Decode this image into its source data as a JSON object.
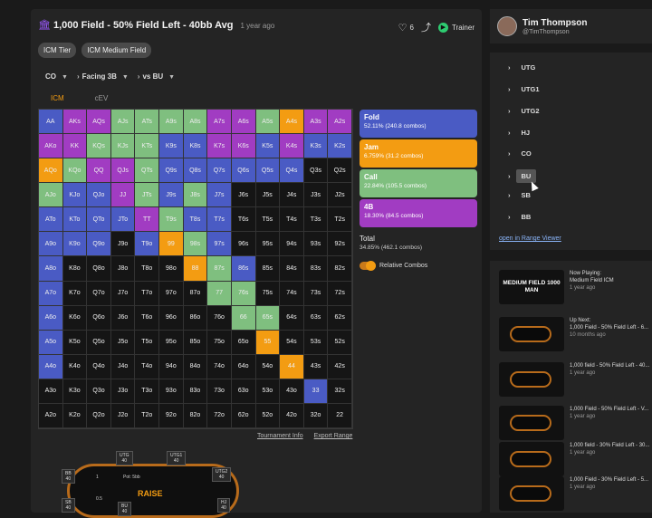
{
  "header": {
    "title": "1,000 Field - 50% Field Left - 40bb Avg",
    "time": "1 year ago",
    "likes": "6",
    "trainer_label": "Trainer"
  },
  "chips": [
    "ICM Tier",
    "ICM Medium Field"
  ],
  "selectors": {
    "position": "CO",
    "facing": "Facing 3B",
    "vs": "vs BU"
  },
  "tabs": [
    "ICM",
    "cEV"
  ],
  "colors": {
    "fold": "#4a5bc4",
    "jam": "#f39c12",
    "call": "#7fbf7f",
    "fourbet": "#a13cc2",
    "empty": "#151515"
  },
  "grid": {
    "labels": [
      [
        "AA",
        "AKs",
        "AQs",
        "AJs",
        "ATs",
        "A9s",
        "A8s",
        "A7s",
        "A6s",
        "A5s",
        "A4s",
        "A3s",
        "A2s"
      ],
      [
        "AKo",
        "KK",
        "KQs",
        "KJs",
        "KTs",
        "K9s",
        "K8s",
        "K7s",
        "K6s",
        "K5s",
        "K4s",
        "K3s",
        "K2s"
      ],
      [
        "AQo",
        "KQo",
        "QQ",
        "QJs",
        "QTs",
        "Q9s",
        "Q8s",
        "Q7s",
        "Q6s",
        "Q5s",
        "Q4s",
        "Q3s",
        "Q2s"
      ],
      [
        "AJo",
        "KJo",
        "QJo",
        "JJ",
        "JTs",
        "J9s",
        "J8s",
        "J7s",
        "J6s",
        "J5s",
        "J4s",
        "J3s",
        "J2s"
      ],
      [
        "ATo",
        "KTo",
        "QTo",
        "JTo",
        "TT",
        "T9s",
        "T8s",
        "T7s",
        "T6s",
        "T5s",
        "T4s",
        "T3s",
        "T2s"
      ],
      [
        "A9o",
        "K9o",
        "Q9o",
        "J9o",
        "T9o",
        "99",
        "98s",
        "97s",
        "96s",
        "95s",
        "94s",
        "93s",
        "92s"
      ],
      [
        "A8o",
        "K8o",
        "Q8o",
        "J8o",
        "T8o",
        "98o",
        "88",
        "87s",
        "86s",
        "85s",
        "84s",
        "83s",
        "82s"
      ],
      [
        "A7o",
        "K7o",
        "Q7o",
        "J7o",
        "T7o",
        "97o",
        "87o",
        "77",
        "76s",
        "75s",
        "74s",
        "73s",
        "72s"
      ],
      [
        "A6o",
        "K6o",
        "Q6o",
        "J6o",
        "T6o",
        "96o",
        "86o",
        "76o",
        "66",
        "65s",
        "64s",
        "63s",
        "62s"
      ],
      [
        "A5o",
        "K5o",
        "Q5o",
        "J5o",
        "T5o",
        "95o",
        "85o",
        "75o",
        "65o",
        "55",
        "54s",
        "53s",
        "52s"
      ],
      [
        "A4o",
        "K4o",
        "Q4o",
        "J4o",
        "T4o",
        "94o",
        "84o",
        "74o",
        "64o",
        "54o",
        "44",
        "43s",
        "42s"
      ],
      [
        "A3o",
        "K3o",
        "Q3o",
        "J3o",
        "T3o",
        "93o",
        "83o",
        "73o",
        "63o",
        "53o",
        "43o",
        "33",
        "32s"
      ],
      [
        "A2o",
        "K2o",
        "Q2o",
        "J2o",
        "T2o",
        "92o",
        "82o",
        "72o",
        "62o",
        "52o",
        "42o",
        "32o",
        "22"
      ]
    ],
    "fills": [
      [
        "F",
        "P",
        "P",
        "G",
        "G",
        "G",
        "G",
        "P",
        "P",
        "G",
        "J",
        "P",
        "P"
      ],
      [
        "P",
        "P",
        "G",
        "G",
        "G",
        "F",
        "F",
        "P",
        "P",
        "F",
        "P",
        "F",
        "F"
      ],
      [
        "J",
        "G",
        "P",
        "P",
        "G",
        "F",
        "F",
        "F",
        "F",
        "F",
        "F",
        "E",
        "E"
      ],
      [
        "G",
        "F",
        "F",
        "P",
        "G",
        "F",
        "G",
        "F",
        "E",
        "E",
        "E",
        "E",
        "E"
      ],
      [
        "F",
        "F",
        "F",
        "F",
        "P",
        "G",
        "F",
        "F",
        "E",
        "E",
        "E",
        "E",
        "E"
      ],
      [
        "F",
        "F",
        "F",
        "E",
        "F",
        "J",
        "G",
        "F",
        "E",
        "E",
        "E",
        "E",
        "E"
      ],
      [
        "F",
        "E",
        "E",
        "E",
        "E",
        "E",
        "J",
        "G",
        "F",
        "E",
        "E",
        "E",
        "E"
      ],
      [
        "F",
        "E",
        "E",
        "E",
        "E",
        "E",
        "E",
        "G",
        "G",
        "E",
        "E",
        "E",
        "E"
      ],
      [
        "F",
        "E",
        "E",
        "E",
        "E",
        "E",
        "E",
        "E",
        "G",
        "G",
        "E",
        "E",
        "E"
      ],
      [
        "F",
        "E",
        "E",
        "E",
        "E",
        "E",
        "E",
        "E",
        "E",
        "J",
        "E",
        "E",
        "E"
      ],
      [
        "F",
        "E",
        "E",
        "E",
        "E",
        "E",
        "E",
        "E",
        "E",
        "E",
        "J",
        "E",
        "E"
      ],
      [
        "E",
        "E",
        "E",
        "E",
        "E",
        "E",
        "E",
        "E",
        "E",
        "E",
        "E",
        "F",
        "E"
      ],
      [
        "E",
        "E",
        "E",
        "E",
        "E",
        "E",
        "E",
        "E",
        "E",
        "E",
        "E",
        "E",
        "E"
      ]
    ]
  },
  "legend": [
    {
      "name": "Fold",
      "value": "52.11% (240.8 combos)",
      "key": "fold"
    },
    {
      "name": "Jam",
      "value": "6.759% (31.2 combos)",
      "key": "jam"
    },
    {
      "name": "Call",
      "value": "22.84% (105.5 combos)",
      "key": "call"
    },
    {
      "name": "4B",
      "value": "18.30% (84.5 combos)",
      "key": "4b"
    }
  ],
  "total": {
    "label": "Total",
    "value": "34.85% (462.1 combos)"
  },
  "toggle_label": "Relative Combos",
  "links": [
    "Tournament Info",
    "Export Range"
  ],
  "poker_table": {
    "seats": [
      {
        "name": "UTG",
        "stack": "40"
      },
      {
        "name": "UTG1",
        "stack": "40"
      },
      {
        "name": "UTG2",
        "stack": "40"
      },
      {
        "name": "BB",
        "stack": "40"
      },
      {
        "name": "SB",
        "stack": "40"
      },
      {
        "name": "BU",
        "stack": "40"
      },
      {
        "name": "HJ",
        "stack": "40"
      }
    ],
    "logo": "RAISE",
    "pot_label": "Pot: 5bb",
    "seat_numbers": [
      "1",
      "0.5"
    ]
  },
  "profile": {
    "name": "Tim Thompson",
    "handle": "@TimThompson"
  },
  "positions": [
    "UTG",
    "UTG1",
    "UTG2",
    "HJ",
    "CO",
    "BU",
    "SB",
    "BB"
  ],
  "selected_position": "BU",
  "range_link": "open in Range Viewer",
  "videos": [
    {
      "thumb": "MEDIUM FIELD 1000 MAN",
      "l1": "Now Playing:",
      "l2": "Medium Field ICM",
      "l3": "1 year ago"
    },
    {
      "thumb": "",
      "l1": "Up Next:",
      "l2": "1,000 Field - 50% Field Left - 6...",
      "l3": "10 months ago"
    },
    {
      "thumb": "",
      "l1": "1,000 field - 50% Field Left - 40...",
      "l2": "1 year ago",
      "l3": ""
    },
    {
      "thumb": "",
      "l1": "1,000 Field - 50% Field Left - V...",
      "l2": "1 year ago",
      "l3": ""
    },
    {
      "thumb": "",
      "l1": "1,000 field - 30% Field Left - 30...",
      "l2": "1 year ago",
      "l3": ""
    },
    {
      "thumb": "",
      "l1": "1,000 Field - 30% Field Left - 5...",
      "l2": "1 year ago",
      "l3": ""
    }
  ]
}
